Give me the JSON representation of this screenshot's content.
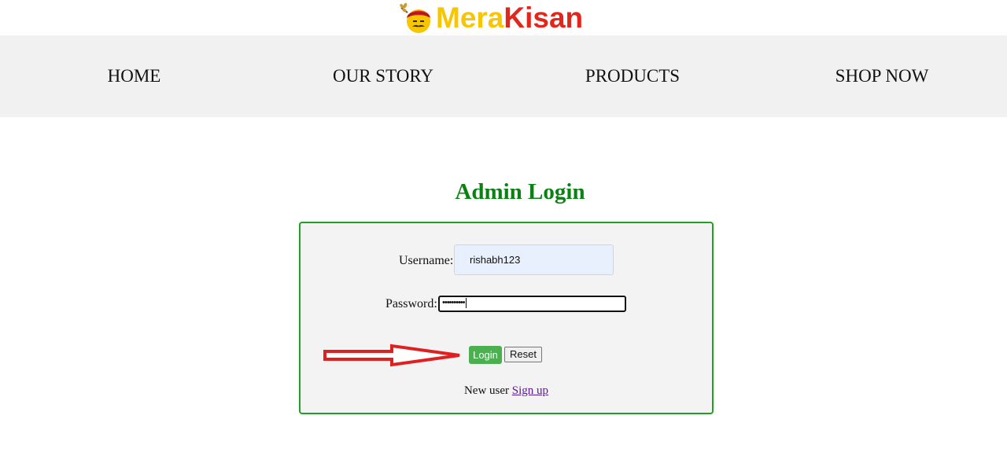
{
  "brand": {
    "name_part1": "Mera",
    "name_part2": "Kisan",
    "logo_icon": "farmer-face-icon",
    "colors": {
      "mera": "#f7c600",
      "kisan": "#e3261b"
    }
  },
  "nav": {
    "items": [
      {
        "label": "HOME"
      },
      {
        "label": "OUR STORY"
      },
      {
        "label": "PRODUCTS"
      },
      {
        "label": "SHOP NOW"
      }
    ]
  },
  "login": {
    "title": "Admin Login",
    "title_color": "#0b8013",
    "username_label": "Username:",
    "username_value": "rishabh123",
    "password_label": "Password:",
    "password_masked": "••••••••••",
    "login_button": "Login",
    "reset_button": "Reset",
    "new_user_text": "New user",
    "signup_link": "Sign up",
    "box_border_color": "#22a022",
    "login_button_color": "#4caf50"
  },
  "annotation": {
    "arrow_icon": "red-arrow-right-icon",
    "color": "#e02020"
  }
}
